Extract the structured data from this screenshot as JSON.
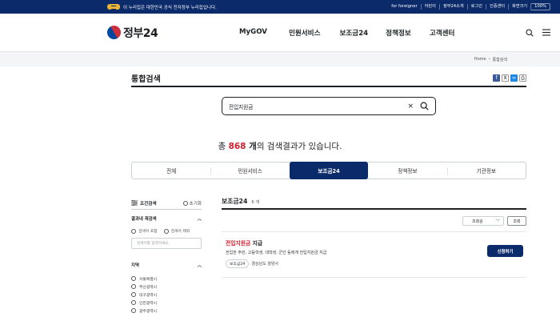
{
  "topbar": {
    "notice": "이 누리집은 대한민국 공식 전자정부 누리집입니다.",
    "links": [
      "for foreigner",
      "어린이",
      "정부24소개",
      "로그인",
      "인증센터",
      "화면크기"
    ],
    "zoom": "100%"
  },
  "header": {
    "logo_text": "정부24",
    "nav": [
      "MyGOV",
      "민원서비스",
      "보조금24",
      "정책정보",
      "고객센터"
    ]
  },
  "breadcrumb": {
    "home": "Home",
    "current": "통합검색"
  },
  "page": {
    "title": "통합검색"
  },
  "search": {
    "query": "전입지원금"
  },
  "results_count": {
    "prefix": "총 ",
    "number": "868",
    "unit": " 개",
    "suffix": "의 검색결과가 있습니다."
  },
  "tabs": [
    "전체",
    "민원서비스",
    "보조금24",
    "정책정보",
    "기관정보"
  ],
  "active_tab": "보조금24",
  "sidebar": {
    "heading": "조건검색",
    "reset": "초기화",
    "within_label": "결과내 재검색",
    "include": "검색어 포함",
    "exclude": "검색어 제외",
    "input_placeholder": "검색어를 입력하세요.",
    "region_label": "지역",
    "regions": [
      "서울특별시",
      "부산광역시",
      "대구광역시",
      "인천광역시",
      "광주광역시"
    ]
  },
  "main": {
    "section_title": "보조금24",
    "section_count": "6 개",
    "sort_value": "조회순",
    "sort_button": "조회",
    "results": [
      {
        "title_highlight": "전입지원금",
        "title_rest": " 지급",
        "desc": "전입한 주민, 고등학생, 대학생, 군인 등에게 전입지원금 지급",
        "badge": "보조금24",
        "agency": "경상남도 양양사",
        "apply": "신청하기"
      }
    ]
  },
  "colors": {
    "navy": "#0b2a6a",
    "highlight": "#d11f2e"
  }
}
